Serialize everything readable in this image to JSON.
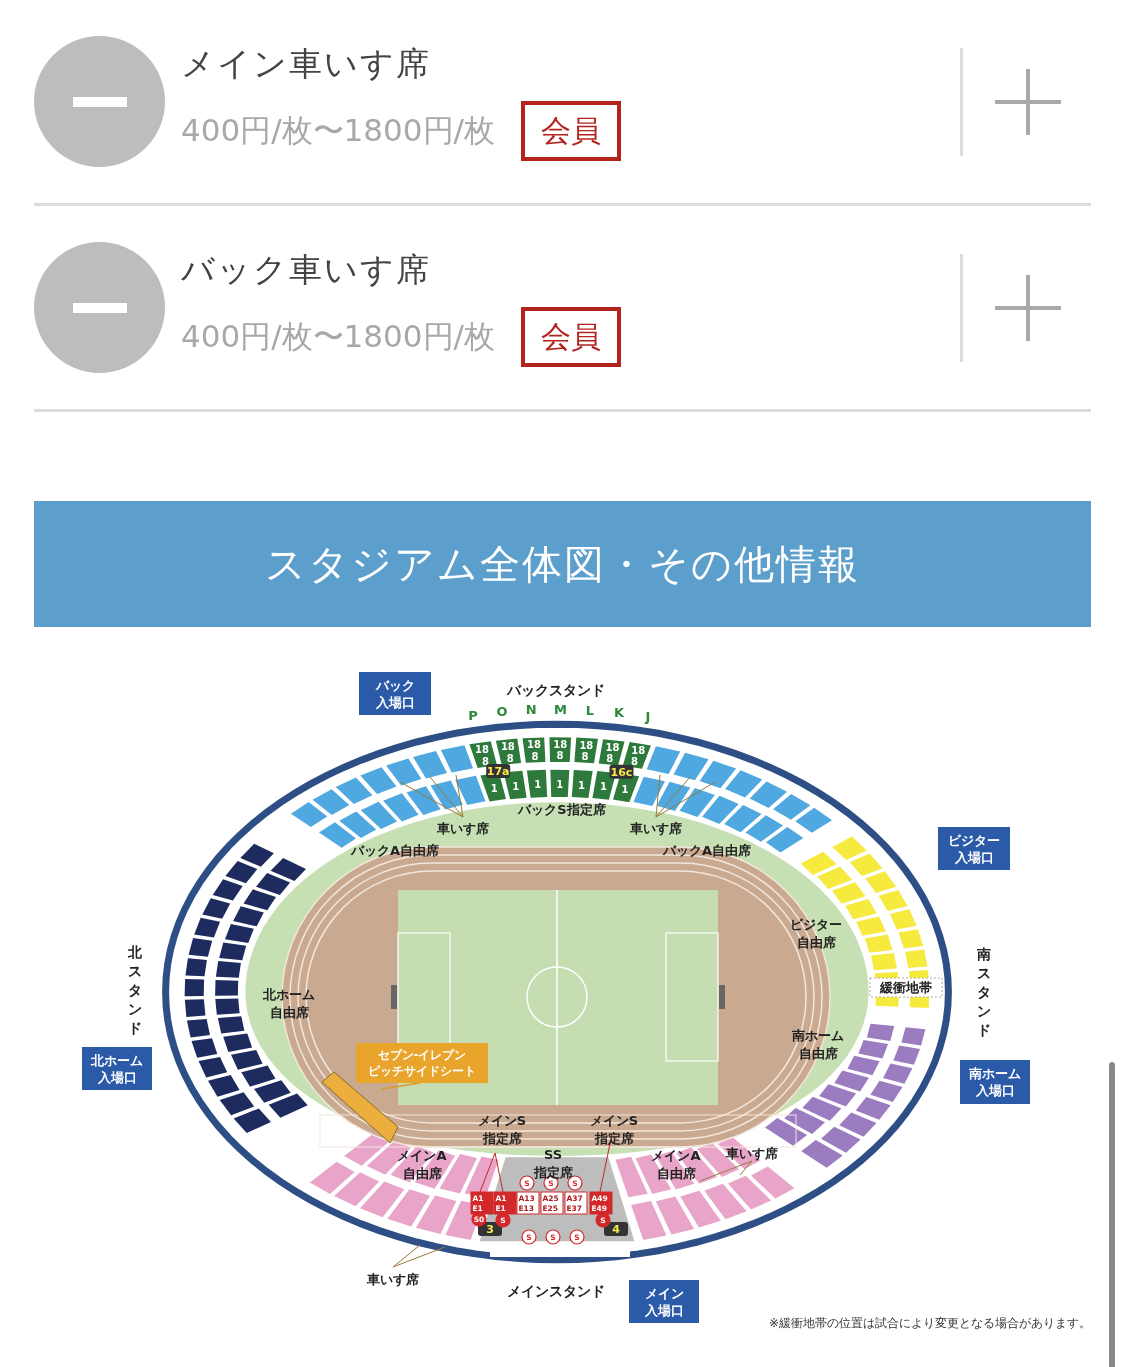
{
  "ticket_rows": [
    {
      "name": "メイン車いす席",
      "price": "400円/枚〜1800円/枚",
      "badge": "会員",
      "decrement_disabled": true
    },
    {
      "name": "バック車いす席",
      "price": "400円/枚〜1800円/枚",
      "badge": "会員",
      "decrement_disabled": true
    }
  ],
  "section_header": "スタジアム全体図・その他情報",
  "stadium_map": {
    "labels": [
      {
        "kind": "entrance",
        "lines": [
          "バック",
          "入場口"
        ]
      },
      {
        "kind": "stand",
        "lines": [
          "バックスタンド"
        ]
      },
      {
        "kind": "area",
        "lines": [
          "車いす席"
        ]
      },
      {
        "kind": "area",
        "lines": [
          "車いす席"
        ]
      },
      {
        "kind": "area",
        "lines": [
          "バックS指定席"
        ]
      },
      {
        "kind": "area",
        "lines": [
          "バックA自由席"
        ]
      },
      {
        "kind": "area",
        "lines": [
          "バックA自由席"
        ]
      },
      {
        "kind": "entrance",
        "lines": [
          "ビジター",
          "入場口"
        ]
      },
      {
        "kind": "area",
        "lines": [
          "ビジター",
          "自由席"
        ]
      },
      {
        "kind": "stand_vertical",
        "lines": [
          "北スタンド"
        ]
      },
      {
        "kind": "area",
        "lines": [
          "北ホーム",
          "自由席"
        ]
      },
      {
        "kind": "buffer",
        "lines": [
          "緩衝地帯"
        ]
      },
      {
        "kind": "stand_vertical",
        "lines": [
          "南スタンド"
        ]
      },
      {
        "kind": "entrance",
        "lines": [
          "北ホーム",
          "入場口"
        ]
      },
      {
        "kind": "area",
        "lines": [
          "南ホーム",
          "自由席"
        ]
      },
      {
        "kind": "promo",
        "lines": [
          "セブン-イレブン",
          "ピッチサイドシート"
        ]
      },
      {
        "kind": "entrance",
        "lines": [
          "南ホーム",
          "入場口"
        ]
      },
      {
        "kind": "area",
        "lines": [
          "メインS",
          "指定席"
        ]
      },
      {
        "kind": "area",
        "lines": [
          "メインS",
          "指定席"
        ]
      },
      {
        "kind": "area",
        "lines": [
          "メインA",
          "自由席"
        ]
      },
      {
        "kind": "area",
        "lines": [
          "SS",
          "指定席"
        ]
      },
      {
        "kind": "area",
        "lines": [
          "メインA",
          "自由席"
        ]
      },
      {
        "kind": "area",
        "lines": [
          "車いす席"
        ]
      },
      {
        "kind": "area",
        "lines": [
          "車いす席"
        ]
      },
      {
        "kind": "stand",
        "lines": [
          "メインスタンド"
        ]
      },
      {
        "kind": "entrance",
        "lines": [
          "メイン",
          "入場口"
        ]
      }
    ],
    "back_s_blocks": [
      {
        "letter": "P",
        "rows": [
          "18",
          "8",
          "1"
        ]
      },
      {
        "letter": "O",
        "rows": [
          "18",
          "8",
          "1"
        ]
      },
      {
        "letter": "N",
        "rows": [
          "18",
          "8",
          "1"
        ]
      },
      {
        "letter": "M",
        "rows": [
          "18",
          "8",
          "1"
        ]
      },
      {
        "letter": "L",
        "rows": [
          "18",
          "8",
          "1"
        ]
      },
      {
        "letter": "K",
        "rows": [
          "18",
          "8",
          "1"
        ]
      },
      {
        "letter": "J",
        "rows": [
          "18",
          "8",
          "1"
        ]
      }
    ],
    "gate_numbers": [
      "17a",
      "16c",
      "3",
      "4"
    ],
    "ss_blocks": [
      {
        "kind": "filled",
        "lines": [
          "A1",
          "E1"
        ]
      },
      {
        "kind": "filled",
        "lines": [
          "A1",
          "E1"
        ]
      },
      {
        "kind": "outlined",
        "lines": [
          "A13",
          "E13"
        ]
      },
      {
        "kind": "outlined",
        "lines": [
          "A25",
          "E25"
        ]
      },
      {
        "kind": "outlined",
        "lines": [
          "A37",
          "E37"
        ]
      },
      {
        "kind": "filled",
        "lines": [
          "A49",
          "E49"
        ]
      }
    ],
    "seat_markers": [
      {
        "kind": "filled",
        "text": "S0"
      },
      {
        "kind": "filled",
        "text": "S"
      },
      {
        "kind": "outlined",
        "text": "S"
      },
      {
        "kind": "outlined",
        "text": "S"
      },
      {
        "kind": "outlined",
        "text": "S"
      },
      {
        "kind": "outlined",
        "text": "S"
      },
      {
        "kind": "outlined",
        "text": "S"
      },
      {
        "kind": "outlined",
        "text": "S"
      },
      {
        "kind": "filled",
        "text": "S"
      }
    ],
    "note": "※緩衝地帯の位置は試合により変更となる場合があります。"
  }
}
